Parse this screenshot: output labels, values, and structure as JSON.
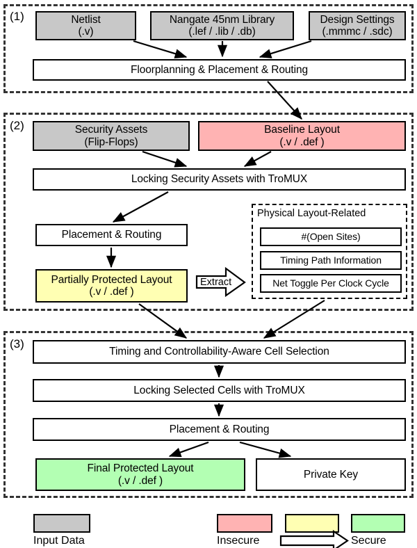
{
  "figure": {
    "type": "flowchart",
    "title": "TroMUX logic-locking design flow"
  },
  "sections": [
    {
      "id": "1",
      "label": "(1)"
    },
    {
      "id": "2",
      "label": "(2)"
    },
    {
      "id": "3",
      "label": "(3)"
    }
  ],
  "stage1": {
    "netlist": {
      "line1": "Netlist",
      "line2": "(.v)",
      "fill": "#c8c8c8"
    },
    "library": {
      "line1": "Nangate 45nm Library",
      "line2": "(.lef / .lib / .db)",
      "fill": "#c8c8c8"
    },
    "settings": {
      "line1": "Design Settings",
      "line2": "(.mmmc / .sdc)",
      "fill": "#c8c8c8"
    },
    "process": {
      "line1": "Floorplanning & Placement & Routing",
      "fill": "#ffffff"
    }
  },
  "stage2": {
    "assets": {
      "line1": "Security Assets",
      "line2": "(Flip-Flops)",
      "fill": "#c8c8c8"
    },
    "baseline": {
      "line1": "Baseline Layout",
      "line2": "(.v / .def )",
      "fill": "#ffb3b3"
    },
    "locking": {
      "line1": "Locking Security Assets with TroMUX",
      "fill": "#ffffff"
    },
    "pnr": {
      "line1": "Placement & Routing",
      "fill": "#ffffff"
    },
    "partial": {
      "line1": "Partially Protected Layout",
      "line2": "(.v / .def )",
      "fill": "#ffffb3"
    },
    "extract_label": "Extract",
    "physical": {
      "title": "Physical Layout-Related",
      "items": [
        "#(Open Sites)",
        "Timing Path Information",
        "Net Toggle Per Clock Cycle"
      ]
    }
  },
  "stage3": {
    "selection": {
      "line1": "Timing and Controllability-Aware Cell Selection",
      "fill": "#ffffff"
    },
    "locking": {
      "line1": "Locking Selected Cells with TroMUX",
      "fill": "#ffffff"
    },
    "pnr": {
      "line1": "Placement & Routing",
      "fill": "#ffffff"
    },
    "final": {
      "line1": "Final Protected Layout",
      "line2": "(.v / .def )",
      "fill": "#b3ffb3"
    },
    "key": {
      "line1": "Private Key",
      "fill": "#ffffff"
    }
  },
  "legend": {
    "input_data": {
      "label": "Input Data",
      "color": "#c8c8c8"
    },
    "insecure": {
      "label": "Insecure",
      "color": "#ffb3b3"
    },
    "intermediate": {
      "color": "#ffffb3"
    },
    "secure": {
      "label": "Secure",
      "color": "#b3ffb3"
    },
    "arrow_icon": "right-arrow-outline"
  }
}
